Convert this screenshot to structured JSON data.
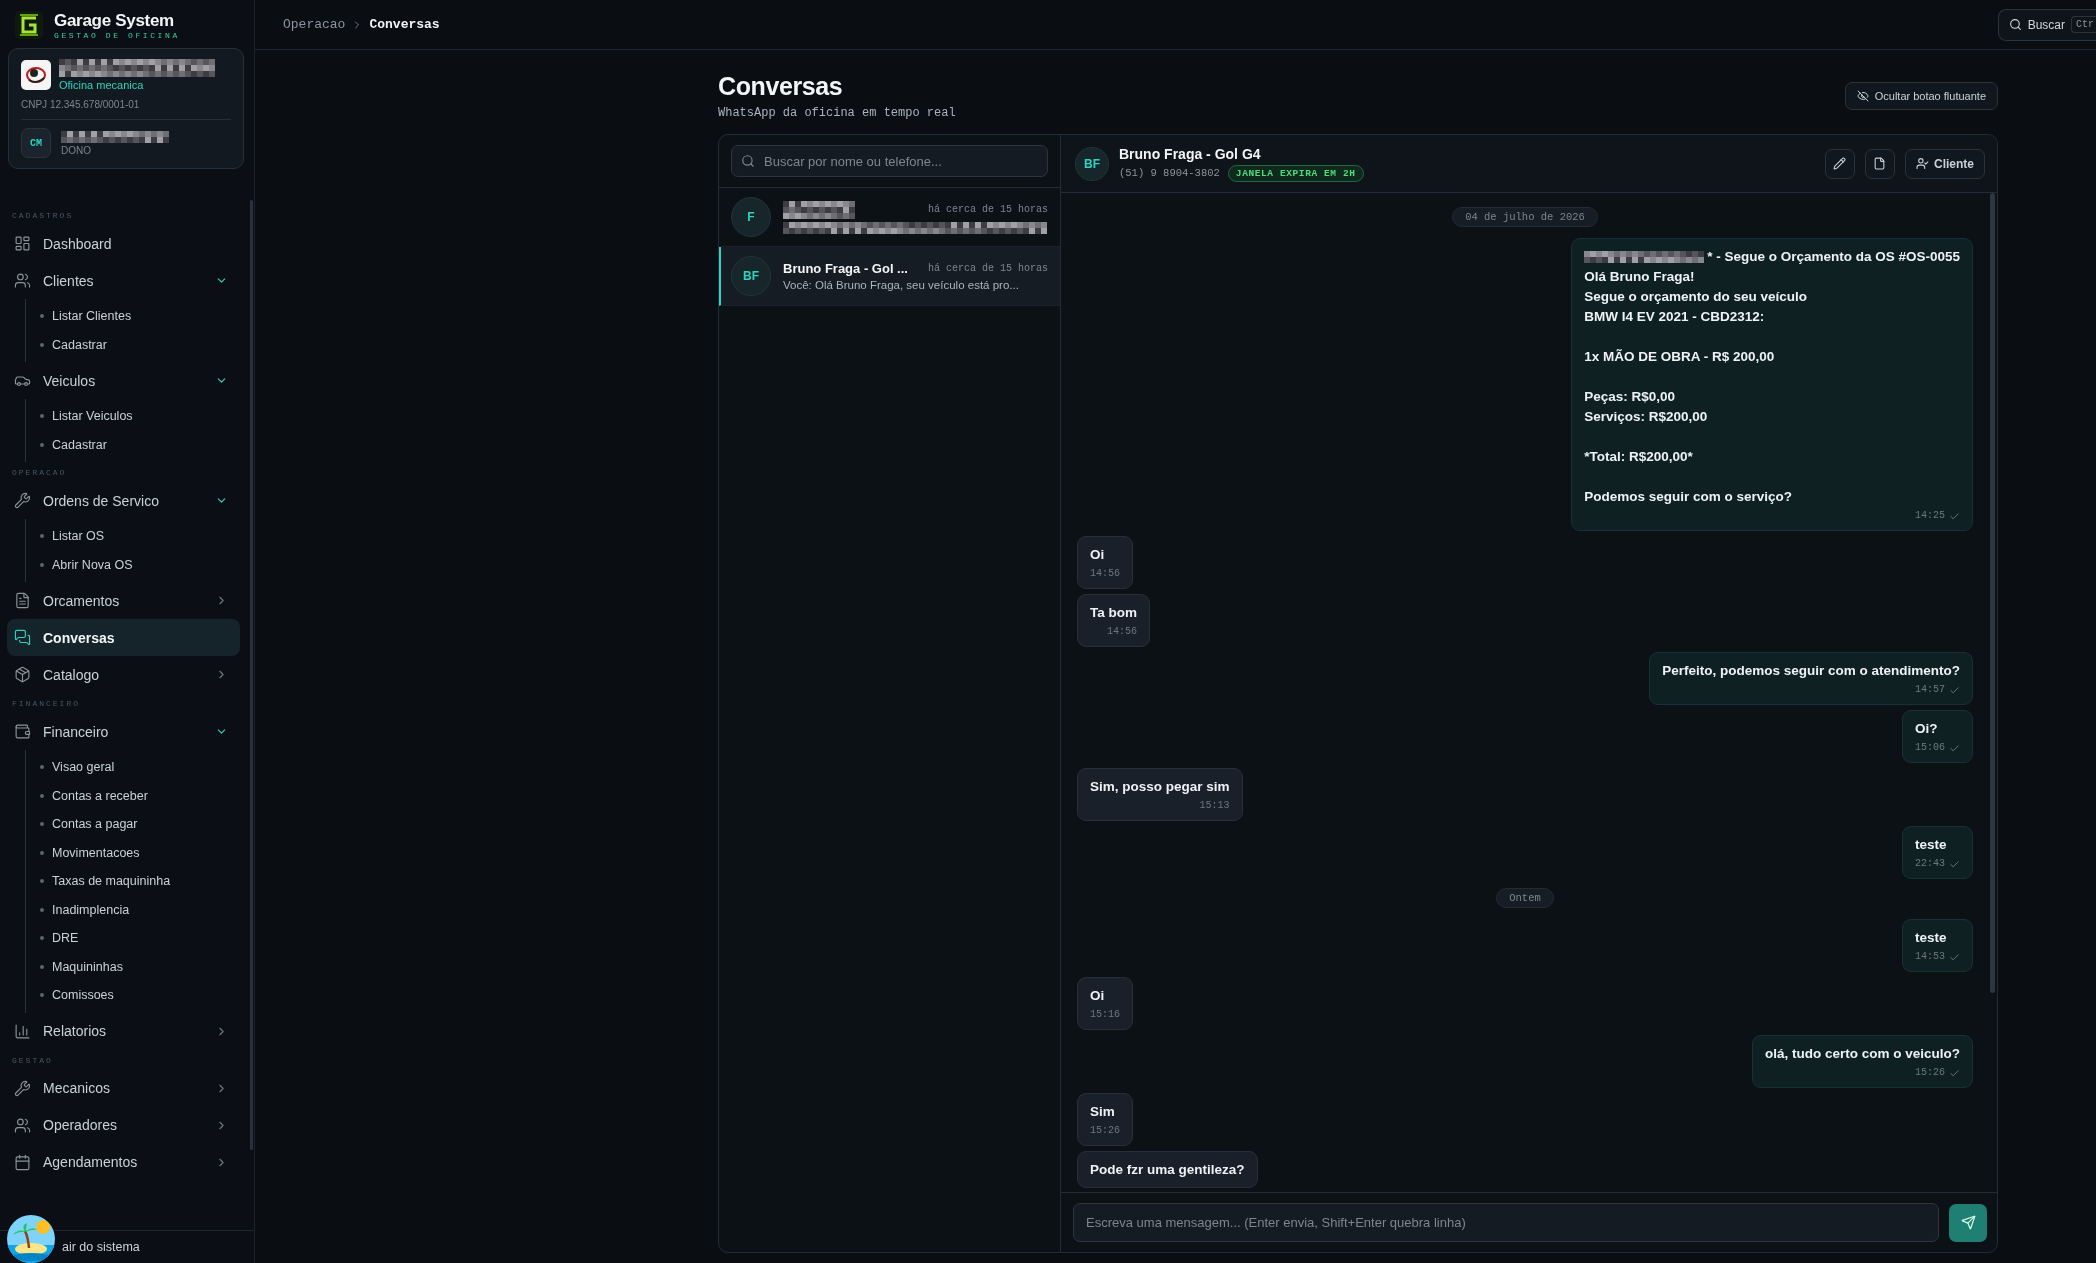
{
  "sidebar": {
    "brand": {
      "title": "Garage System",
      "subtitle": "GESTAO DE OFICINA"
    },
    "company": {
      "redacted": true,
      "type": "Oficina mecanica",
      "cnpj": "CNPJ 12.345.678/0001-01",
      "initials": "CM",
      "role": "DONO"
    },
    "sections": [
      {
        "label": "CADASTROS",
        "items": [
          {
            "label": "Dashboard",
            "selected": false
          },
          {
            "label": "Clientes",
            "selected": false,
            "expanded": true,
            "children": [
              {
                "label": "Listar Clientes"
              },
              {
                "label": "Cadastrar"
              }
            ]
          },
          {
            "label": "Veiculos",
            "selected": false,
            "expanded": true,
            "children": [
              {
                "label": "Listar Veiculos"
              },
              {
                "label": "Cadastrar"
              }
            ]
          }
        ]
      },
      {
        "label": "OPERACAO",
        "items": [
          {
            "label": "Ordens de Servico",
            "selected": false,
            "expanded": true,
            "children": [
              {
                "label": "Listar OS"
              },
              {
                "label": "Abrir Nova OS"
              }
            ]
          },
          {
            "label": "Orcamentos",
            "selected": false,
            "expanded": false
          },
          {
            "label": "Conversas",
            "selected": true
          },
          {
            "label": "Catalogo",
            "selected": false,
            "expanded": false
          }
        ]
      },
      {
        "label": "FINANCEIRO",
        "items": [
          {
            "label": "Financeiro",
            "selected": false,
            "expanded": true,
            "children": [
              {
                "label": "Visao geral"
              },
              {
                "label": "Contas a receber"
              },
              {
                "label": "Contas a pagar"
              },
              {
                "label": "Movimentacoes"
              },
              {
                "label": "Taxas de maquininha"
              },
              {
                "label": "Inadimplencia"
              },
              {
                "label": "DRE"
              },
              {
                "label": "Maquininhas"
              },
              {
                "label": "Comissoes"
              }
            ]
          },
          {
            "label": "Relatorios",
            "selected": false,
            "expanded": false
          }
        ]
      },
      {
        "label": "GESTAO",
        "items": [
          {
            "label": "Mecanicos",
            "selected": false,
            "expanded": false
          },
          {
            "label": "Operadores",
            "selected": false,
            "expanded": false
          },
          {
            "label": "Agendamentos",
            "selected": false,
            "expanded": false
          }
        ]
      }
    ],
    "footer": {
      "label": "air do sistema"
    }
  },
  "header": {
    "breadcrumb": [
      "Operacao",
      "Conversas"
    ],
    "search": {
      "label": "Buscar",
      "shortcut": "Ctr"
    }
  },
  "page": {
    "title": "Conversas",
    "subtitle": "WhatsApp da oficina em tempo real",
    "hide_button": "Ocultar botao flutuante"
  },
  "conversations": {
    "search": {
      "placeholder": "Buscar por nome ou telefone..."
    },
    "items": [
      {
        "initials": "F",
        "redacted": true,
        "time": "há cerca de 15 horas",
        "selected": false
      },
      {
        "initials": "BF",
        "redacted": false,
        "name": "Bruno Fraga - Gol ...",
        "time": "há cerca de 15 horas",
        "preview": "Você: Olá Bruno Fraga, seu veículo está pro...",
        "selected": true
      }
    ]
  },
  "chat": {
    "initials": "BF",
    "name": "Bruno Fraga - Gol G4",
    "phone": "(51) 9 8904-3802",
    "badge": "JANELA EXPIRA EM 2H",
    "client_button": "Cliente",
    "messages": [
      {
        "kind": "date",
        "text": "04 de julho de 2026"
      },
      {
        "kind": "sent",
        "redacted": true,
        "heading": "* - Segue o Orçamento da OS #OS-0055",
        "text": "Olá Bruno Fraga!\nSegue o orçamento do seu veículo\nBMW I4 EV 2021 - CBD2312:\n\n1x MÃO DE OBRA - R$ 200,00\n\nPeças: R$0,00\nServiços: R$200,00\n\n*Total: R$200,00*\n\nPodemos seguir com o serviço?",
        "time": "14:25"
      },
      {
        "kind": "received",
        "text": "Oi",
        "time": "14:56"
      },
      {
        "kind": "received",
        "text": "Ta bom",
        "time": "14:56"
      },
      {
        "kind": "sent",
        "text": "Perfeito, podemos seguir com o atendimento?",
        "time": "14:57"
      },
      {
        "kind": "sent",
        "text": "Oi?",
        "time": "15:06"
      },
      {
        "kind": "received",
        "text": "Sim, posso pegar sim",
        "time": "15:13"
      },
      {
        "kind": "sent",
        "text": "teste",
        "time": "22:43"
      },
      {
        "kind": "date",
        "text": "Ontem"
      },
      {
        "kind": "sent",
        "text": "teste",
        "time": "14:53"
      },
      {
        "kind": "received",
        "text": "Oi",
        "time": "15:16"
      },
      {
        "kind": "sent",
        "text": "olá, tudo certo com o veiculo?",
        "time": "15:26"
      },
      {
        "kind": "received",
        "text": "Sim",
        "time": "15:26"
      },
      {
        "kind": "received",
        "text": "Pode fzr uma gentileza?"
      }
    ],
    "composer": {
      "placeholder": "Escreva uma mensagem... (Enter envia, Shift+Enter quebra linha)"
    }
  }
}
